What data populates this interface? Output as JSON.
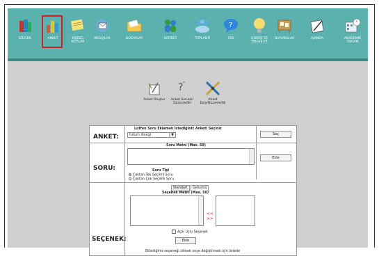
{
  "nav": [
    {
      "label": "SÖZLÜK",
      "icon": "book-icon"
    },
    {
      "label": "ANKET",
      "icon": "bar-chart-icon",
      "active": true
    },
    {
      "label": "KİŞİSEL\nNOTLAR",
      "icon": "notes-icon"
    },
    {
      "label": "MESAJLAR",
      "icon": "mail-icon"
    },
    {
      "label": "DOSYALAR",
      "icon": "folder-icon"
    },
    {
      "label": "SOHBET",
      "icon": "chat-people-icon"
    },
    {
      "label": "TOPLANTI",
      "icon": "meeting-icon"
    },
    {
      "label": "SSS",
      "icon": "speech-bubble-icon"
    },
    {
      "label": "GÖRÜŞ VE\nÖNERİLER",
      "icon": "lightbulb-icon"
    },
    {
      "label": "DUYURULAR",
      "icon": "board-icon"
    },
    {
      "label": "AJANDA",
      "icon": "agenda-icon"
    },
    {
      "label": "AKADEMİK\nTAKVİM",
      "icon": "calendar-icon"
    }
  ],
  "subnav": [
    {
      "label": "Anket Oluştur",
      "icon": "create-survey-icon"
    },
    {
      "label": "Anket Soruları\nDüzenle/Sil",
      "icon": "edit-questions-icon"
    },
    {
      "label": "Anket\nEkle/Düzenle/Sil",
      "icon": "tools-icon"
    }
  ],
  "anket": {
    "section_label": "ANKET:",
    "instruction": "Lütfen Soru Eklemek İstediğiniz Anketi Seçiniz",
    "selected": "futum illcegi",
    "select_button": "Seç"
  },
  "soru": {
    "section_label": "SORU:",
    "text_header": "Soru Metni (Max. 50)",
    "add_button": "Ekle",
    "type_header": "Soru Tipi",
    "options": [
      {
        "label": "Çoktan Tek Seçimli Soru",
        "checked": true
      },
      {
        "label": "Çoktan Çok Seçimli Soru",
        "checked": false
      }
    ]
  },
  "secenek": {
    "section_label": "SEÇENEK:",
    "tabs": [
      {
        "label": "Standart",
        "active": false
      },
      {
        "label": "Gelişmiş",
        "active": true
      }
    ],
    "text_header": "Seçenek Metni (Max. 50)",
    "arrow_right": "<<",
    "arrow_left": ">>",
    "open_checkbox": "Açık Uçlu Seçenek",
    "add_button": "Ekle",
    "footer_note": "Eklediğiniz seçeneği silmek veya değiştirmek için listede"
  },
  "colors": {
    "accent": "#5ab1ad",
    "active_border": "#d21f1f"
  }
}
